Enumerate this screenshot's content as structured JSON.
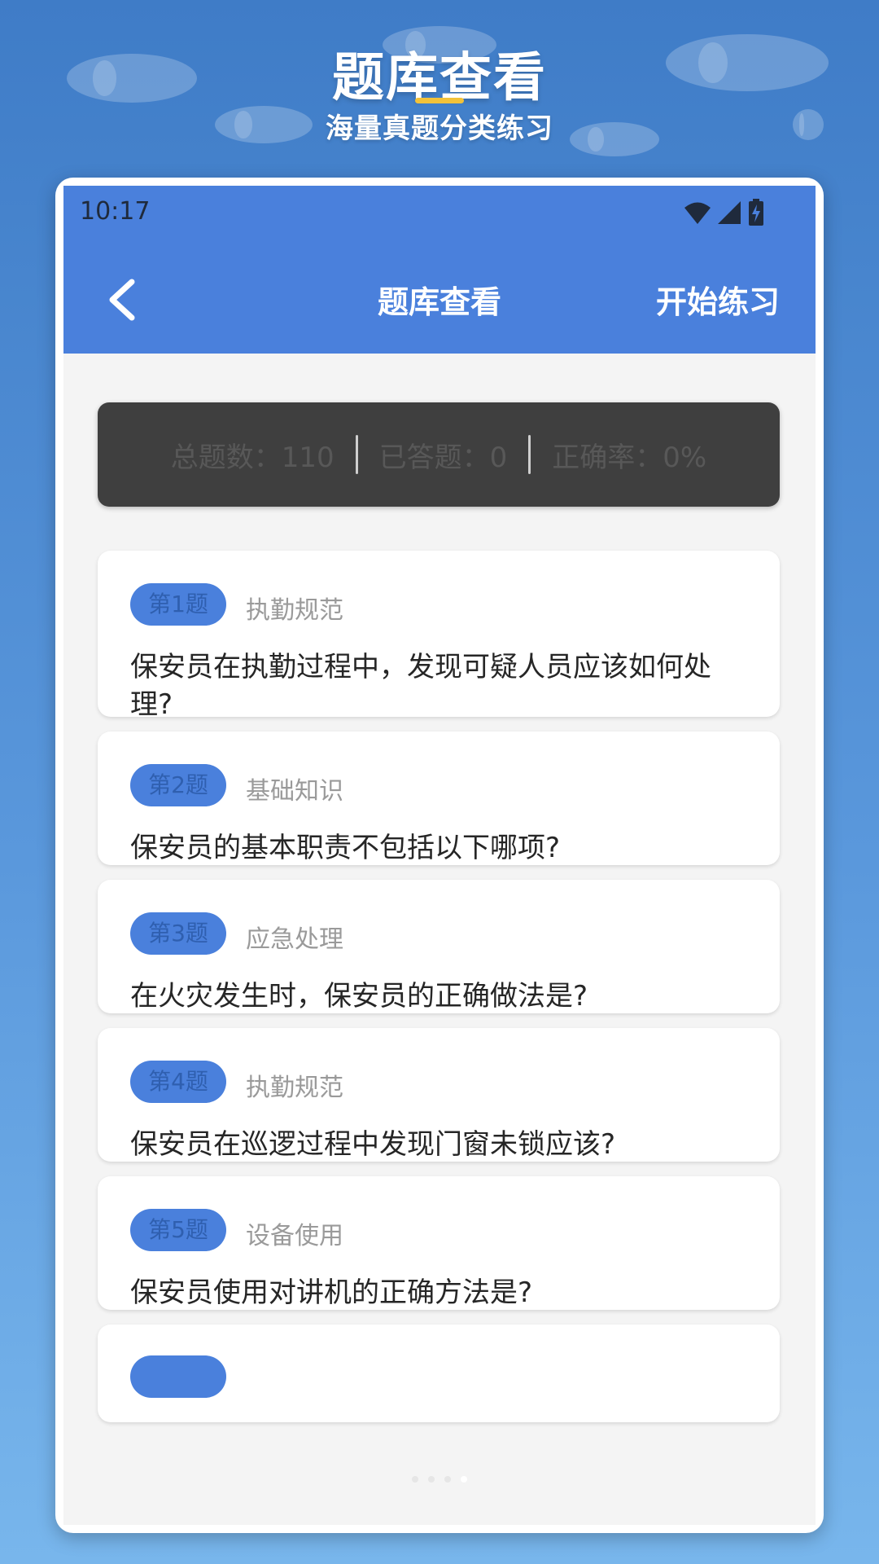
{
  "promo": {
    "title": "题库查看",
    "subtitle": "海量真题分类练习"
  },
  "status_bar": {
    "time": "10:17",
    "icons": [
      "wifi-icon",
      "signal-icon",
      "battery-charging-icon"
    ]
  },
  "toolbar": {
    "back_icon": "chevron-left-icon",
    "title": "题库查看",
    "action_label": "开始练习"
  },
  "stats": {
    "total": "总题数：110",
    "answered": "已答题：0",
    "accuracy": "正确率：0%"
  },
  "questions": [
    {
      "badge": "第1题",
      "category": "执勤规范",
      "text": "保安员在执勤过程中，发现可疑人员应该如何处理?"
    },
    {
      "badge": "第2题",
      "category": "基础知识",
      "text": "保安员的基本职责不包括以下哪项?"
    },
    {
      "badge": "第3题",
      "category": "应急处理",
      "text": "在火灾发生时，保安员的正确做法是?"
    },
    {
      "badge": "第4题",
      "category": "执勤规范",
      "text": "保安员在巡逻过程中发现门窗未锁应该?"
    },
    {
      "badge": "第5题",
      "category": "设备使用",
      "text": "保安员使用对讲机的正确方法是?"
    }
  ],
  "colors": {
    "accent": "#4a80dc",
    "stats_bg": "#3f3f3f",
    "badge_text": "#2f5faf",
    "underline": "#f2c23a"
  }
}
